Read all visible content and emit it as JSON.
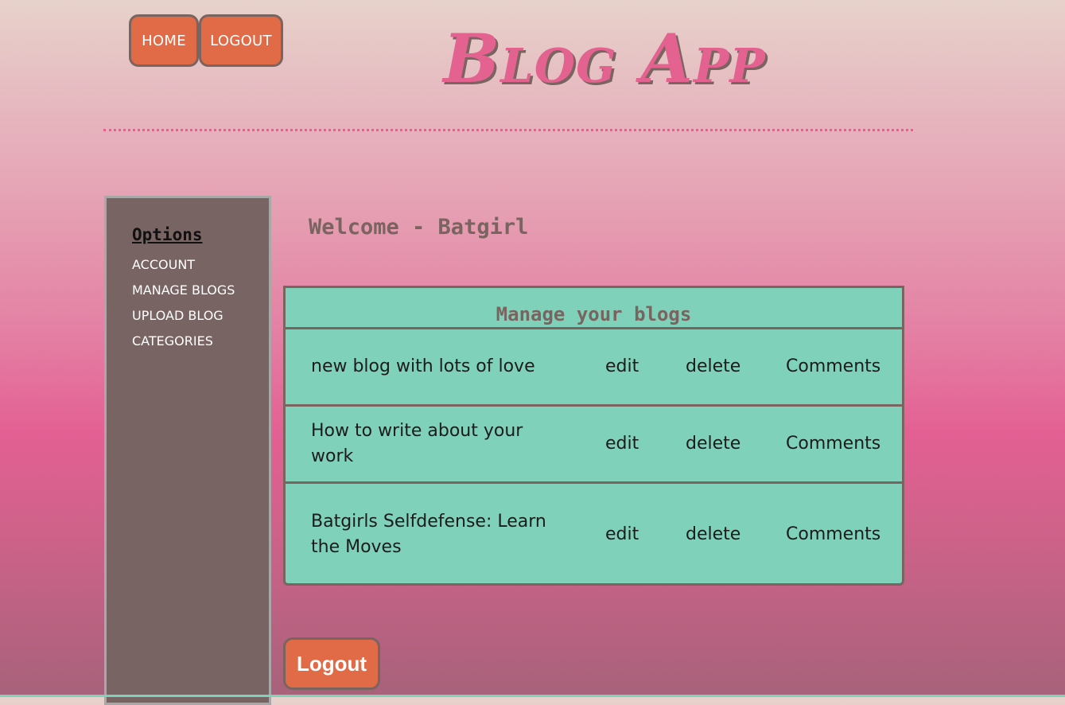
{
  "header": {
    "home_label": "HOME",
    "logout_label": "LOGOUT",
    "brand": "Blog App"
  },
  "sidebar": {
    "title": "Options",
    "items": [
      {
        "label": "ACCOUNT"
      },
      {
        "label": "MANAGE BLOGS"
      },
      {
        "label": "UPLOAD BLOG"
      },
      {
        "label": "CATEGORIES"
      }
    ]
  },
  "main": {
    "welcome": "Welcome - Batgirl",
    "table": {
      "title": "Manage your blogs",
      "rows": [
        {
          "title": "new blog with lots of love",
          "edit": "edit",
          "delete": "delete",
          "comments": "Comments"
        },
        {
          "title": "How to write about your work",
          "edit": "edit",
          "delete": "delete",
          "comments": "Comments"
        },
        {
          "title": "Batgirls Selfdefense: Learn the Moves",
          "edit": "edit",
          "delete": "delete",
          "comments": "Comments"
        }
      ]
    },
    "logout_label": "Logout"
  },
  "colors": {
    "accent_button": "#e06b46",
    "brand_pink": "#e3628f",
    "sidebar_bg": "#786462",
    "table_bg": "#7fd1b9",
    "border": "#7a6460"
  }
}
